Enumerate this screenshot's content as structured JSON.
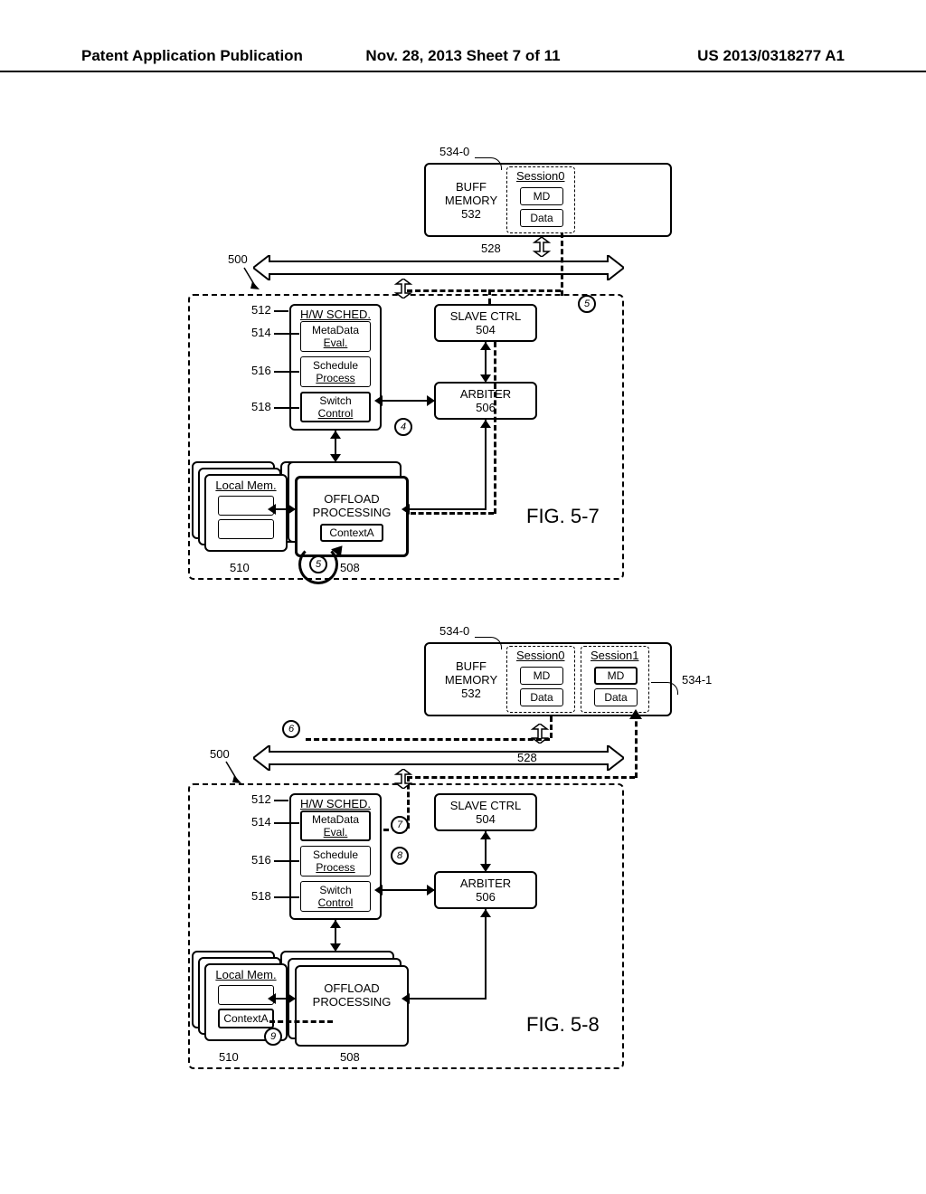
{
  "header": {
    "left": "Patent Application Publication",
    "center": "Nov. 28, 2013  Sheet 7 of 11",
    "right": "US 2013/0318277 A1"
  },
  "common": {
    "ref_500": "500",
    "ref_504": "504",
    "ref_506": "506",
    "ref_508": "508",
    "ref_510": "510",
    "ref_512": "512",
    "ref_514": "514",
    "ref_516": "516",
    "ref_518": "518",
    "ref_528": "528",
    "ref_532": "532",
    "ref_534_0": "534-0",
    "ref_534_1": "534-1",
    "buff_memory_1": "BUFF",
    "buff_memory_2": "MEMORY",
    "session0": "Session0",
    "session1": "Session1",
    "md": "MD",
    "data": "Data",
    "hw_sched": "H/W SCHED.",
    "metadata_eval_1": "MetaData",
    "metadata_eval_2": "Eval.",
    "schedule_process_1": "Schedule",
    "schedule_process_2": "Process",
    "switch_control_1": "Switch",
    "switch_control_2": "Control",
    "slave_ctrl": "SLAVE CTRL",
    "arbiter": "ARBITER",
    "offload_processing_1": "OFFLOAD",
    "offload_processing_2": "PROCESSING",
    "local_mem": "Local Mem.",
    "contextA": "ContextA"
  },
  "fig57": {
    "label": "FIG. 5-7",
    "step4": "4",
    "step5a": "5",
    "step5b": "5"
  },
  "fig58": {
    "label": "FIG. 5-8",
    "step6": "6",
    "step7": "7",
    "step8": "8",
    "step9": "9"
  }
}
